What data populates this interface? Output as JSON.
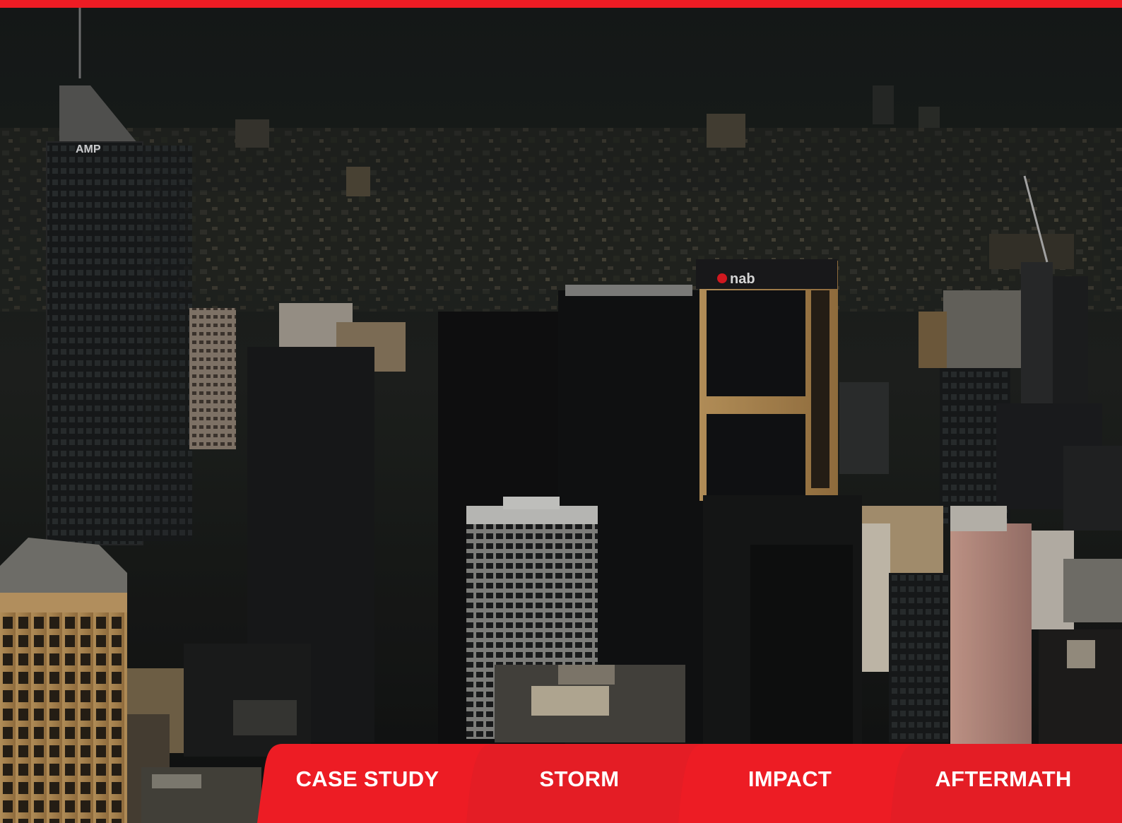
{
  "signs": {
    "amp": "AMP",
    "nab": "nab"
  },
  "tabs": [
    {
      "label": "CASE STUDY"
    },
    {
      "label": "STORM"
    },
    {
      "label": "IMPACT"
    },
    {
      "label": "AFTERMATH"
    }
  ],
  "colors": {
    "accent": "#ed1c24",
    "sky": "#1b201f",
    "tab_text": "#ffffff"
  },
  "icons": [
    "city-skyline-photo"
  ]
}
